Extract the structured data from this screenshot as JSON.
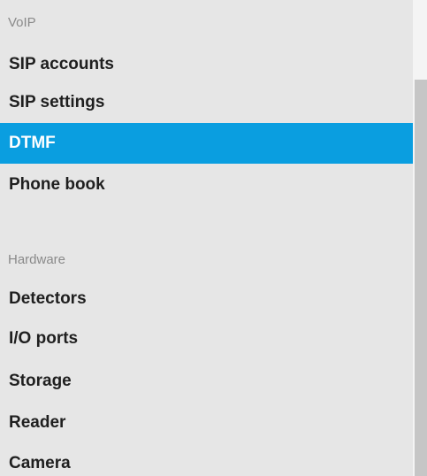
{
  "sections": [
    {
      "header": "VoIP",
      "items": [
        {
          "label": "SIP accounts",
          "active": false
        },
        {
          "label": "SIP settings",
          "active": false
        },
        {
          "label": "DTMF",
          "active": true
        },
        {
          "label": "Phone book",
          "active": false
        }
      ]
    },
    {
      "header": "Hardware",
      "items": [
        {
          "label": "Detectors",
          "active": false
        },
        {
          "label": "I/O ports",
          "active": false
        },
        {
          "label": "Storage",
          "active": false
        },
        {
          "label": "Reader",
          "active": false
        },
        {
          "label": "Camera",
          "active": false
        }
      ]
    }
  ],
  "colors": {
    "panel_bg": "#e6e6e6",
    "active_bg": "#0a9ee0",
    "active_text": "#ffffff",
    "item_text": "#1f1f1f",
    "header_text": "#8a8a8a"
  }
}
